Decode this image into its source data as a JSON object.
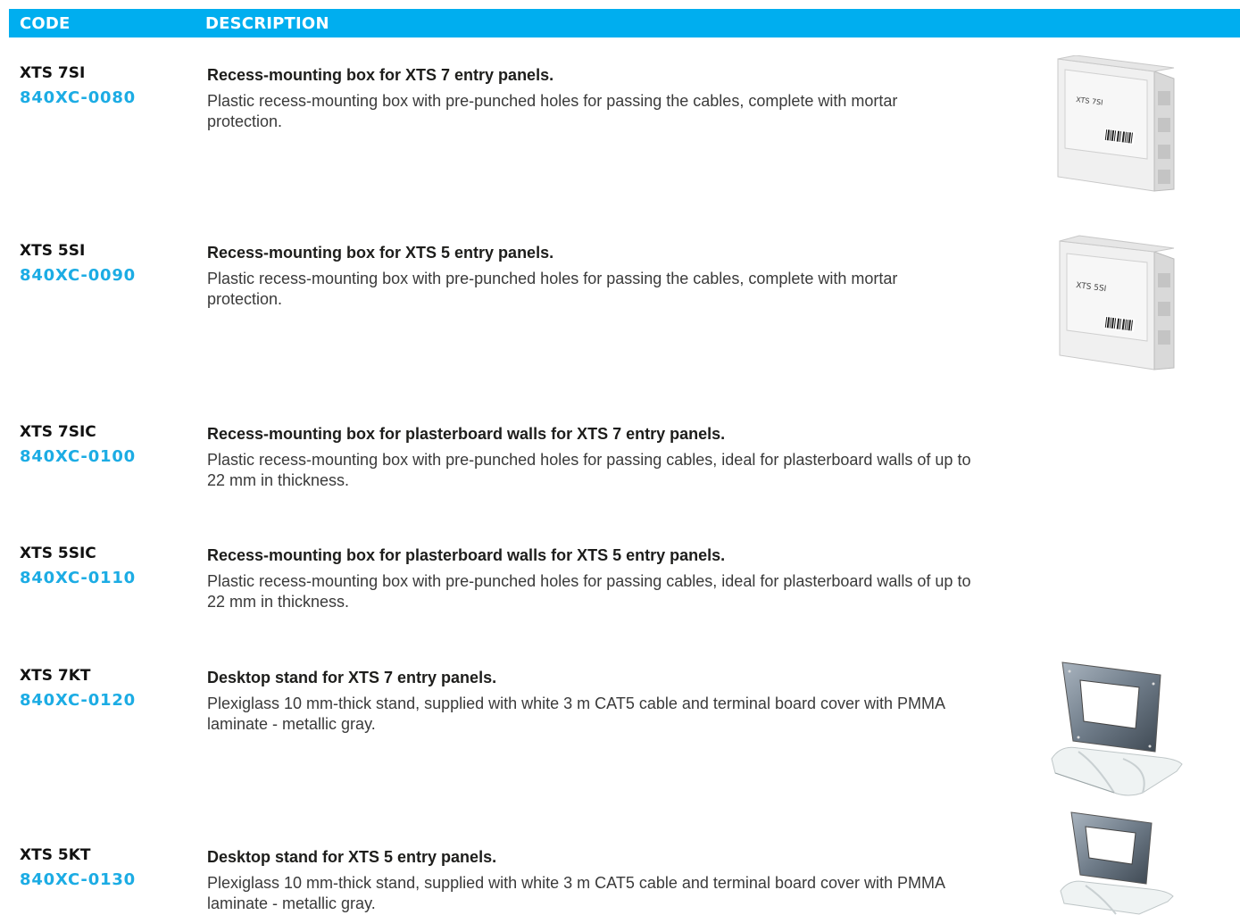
{
  "header": {
    "code": "CODE",
    "description": "DESCRIPTION"
  },
  "items": [
    {
      "model": "XTS 7SI",
      "code": "840XC-0080",
      "title": "Recess-mounting box for XTS 7 entry panels.",
      "description": "Plastic recess-mounting box with pre-punched holes for passing the cables, complete with mortar protection.",
      "image_label": "XTS 7SI"
    },
    {
      "model": "XTS 5SI",
      "code": "840XC-0090",
      "title": "Recess-mounting box for XTS 5 entry panels.",
      "description": "Plastic recess-mounting box with pre-punched holes for passing the cables, complete with mortar protection.",
      "image_label": "XTS 5SI"
    },
    {
      "model": "XTS 7SIC",
      "code": "840XC-0100",
      "title": "Recess-mounting box for plasterboard walls for XTS 7 entry panels.",
      "description": "Plastic recess-mounting box with pre-punched holes for passing cables, ideal for plasterboard walls of up to 22 mm in thickness."
    },
    {
      "model": "XTS 5SIC",
      "code": "840XC-0110",
      "title": "Recess-mounting box for plasterboard walls for XTS 5 entry panels.",
      "description": "Plastic recess-mounting box with pre-punched holes for passing cables, ideal for plasterboard walls of up to 22 mm in thickness."
    },
    {
      "model": "XTS 7KT",
      "code": "840XC-0120",
      "title": "Desktop stand for XTS 7 entry panels.",
      "description": "Plexiglass 10 mm-thick stand, supplied with white 3 m CAT5 cable and terminal board cover with PMMA laminate - metallic gray."
    },
    {
      "model": "XTS 5KT",
      "code": "840XC-0130",
      "title": "Desktop stand for XTS 5 entry panels.",
      "description": "Plexiglass 10 mm-thick stand, supplied with white 3 m CAT5 cable and terminal board cover with PMMA laminate - metallic gray."
    }
  ]
}
